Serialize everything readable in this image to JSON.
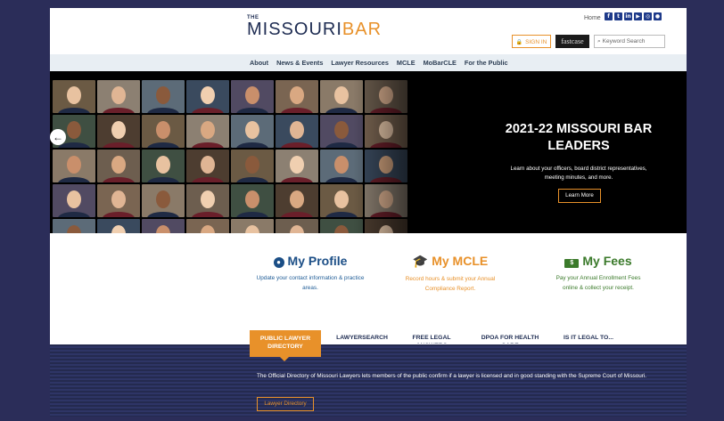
{
  "header": {
    "logo_small": "THE",
    "logo_main": "MISSOURI",
    "logo_accent": "BAR",
    "home_link": "Home",
    "social_icons": [
      "facebook-icon",
      "twitter-icon",
      "linkedin-icon",
      "youtube-icon",
      "instagram-icon",
      "user-icon"
    ],
    "social_glyphs": [
      "f",
      "t",
      "in",
      "▶",
      "◎",
      "●"
    ],
    "sign_in": "SIGN IN",
    "fastcase": "fastcase",
    "search_placeholder": "Keyword Search"
  },
  "nav": {
    "items": [
      "About",
      "News & Events",
      "Lawyer Resources",
      "MCLE",
      "MoBarCLE",
      "For the Public"
    ]
  },
  "hero": {
    "title": "2021-22 MISSOURI BAR LEADERS",
    "subtitle": "Learn about your officers, board district representatives, meeting minutes, and more.",
    "button": "Learn More",
    "prev_arrow": "←"
  },
  "cards": [
    {
      "title": "My Profile",
      "desc": "Update your contact information & practice areas.",
      "color": "#1b4e86"
    },
    {
      "title": "My MCLE",
      "desc": "Record hours & submit your Annual Compliance Report.",
      "color": "#e8912a"
    },
    {
      "title": "My Fees",
      "desc": "Pay your Annual Enrollment Fees online & collect your receipt.",
      "color": "#3b7a2b"
    }
  ],
  "directory": {
    "tabs": [
      "PUBLIC LAWYER DIRECTORY",
      "LAWYERSEARCH",
      "FREE LEGAL ANSWERS",
      "DPOA FOR HEALTH CARE",
      "IS IT LEGAL TO..."
    ],
    "text": "The Official Directory of Missouri Lawyers lets members of the public confirm if a lawyer is licensed and in good standing with the Supreme Court of Missouri.",
    "button": "Lawyer Directory"
  },
  "colors": {
    "navy": "#1e2c52",
    "orange": "#e8912a",
    "background": "#2b2d59"
  }
}
